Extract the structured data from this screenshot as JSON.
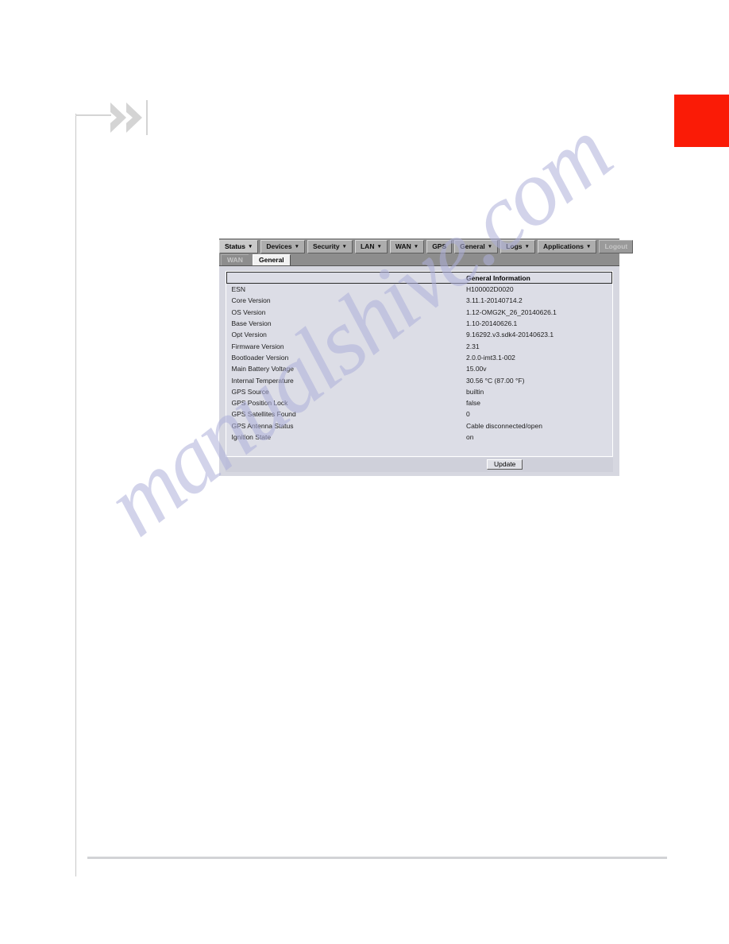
{
  "page": {
    "watermark_text": "manualshive.com",
    "accent_block_color": "#fa1b06",
    "rule_color": "#d2d3d6"
  },
  "router_ui": {
    "nav_tabs": [
      {
        "label": "Status",
        "caret": "▼",
        "state": "active"
      },
      {
        "label": "Devices",
        "caret": "▼",
        "state": "normal"
      },
      {
        "label": "Security",
        "caret": "▼",
        "state": "normal"
      },
      {
        "label": "LAN",
        "caret": "▼",
        "state": "normal"
      },
      {
        "label": "WAN",
        "caret": "▼",
        "state": "normal"
      },
      {
        "label": "GPS",
        "caret": "",
        "state": "normal"
      },
      {
        "label": "General",
        "caret": "▼",
        "state": "normal"
      },
      {
        "label": "Logs",
        "caret": "▼",
        "state": "normal"
      },
      {
        "label": "Applications",
        "caret": "▼",
        "state": "normal"
      },
      {
        "label": "Logout",
        "caret": "",
        "state": "disabled"
      }
    ],
    "sub_tabs": [
      {
        "label": "WAN",
        "state": "inactive"
      },
      {
        "label": "General",
        "state": "active"
      }
    ],
    "table": {
      "header_blank": "",
      "header_title": "General Information",
      "rows": [
        {
          "label": "ESN",
          "value": "H100002D0020"
        },
        {
          "label": "Core Version",
          "value": "3.11.1-20140714.2"
        },
        {
          "label": "OS Version",
          "value": "1.12-OMG2K_26_20140626.1"
        },
        {
          "label": "Base Version",
          "value": "1.10-20140626.1"
        },
        {
          "label": "Opt Version",
          "value": "9.16292.v3.sdk4-20140623.1"
        },
        {
          "label": "Firmware Version",
          "value": "2.31"
        },
        {
          "label": "Bootloader Version",
          "value": "2.0.0-imt3.1-002"
        },
        {
          "label": "Main Battery Voltage",
          "value": "15.00v"
        },
        {
          "label": "Internal Temperature",
          "value": "30.56 °C (87.00 °F)"
        },
        {
          "label": "GPS Source",
          "value": "builtin"
        },
        {
          "label": "GPS Position Lock",
          "value": "false"
        },
        {
          "label": "GPS Satellites Found",
          "value": "0"
        },
        {
          "label": "GPS Antenna Status",
          "value": "Cable disconnected/open"
        },
        {
          "label": "Ignition State",
          "value": "on"
        }
      ]
    },
    "update_button_label": "Update"
  }
}
